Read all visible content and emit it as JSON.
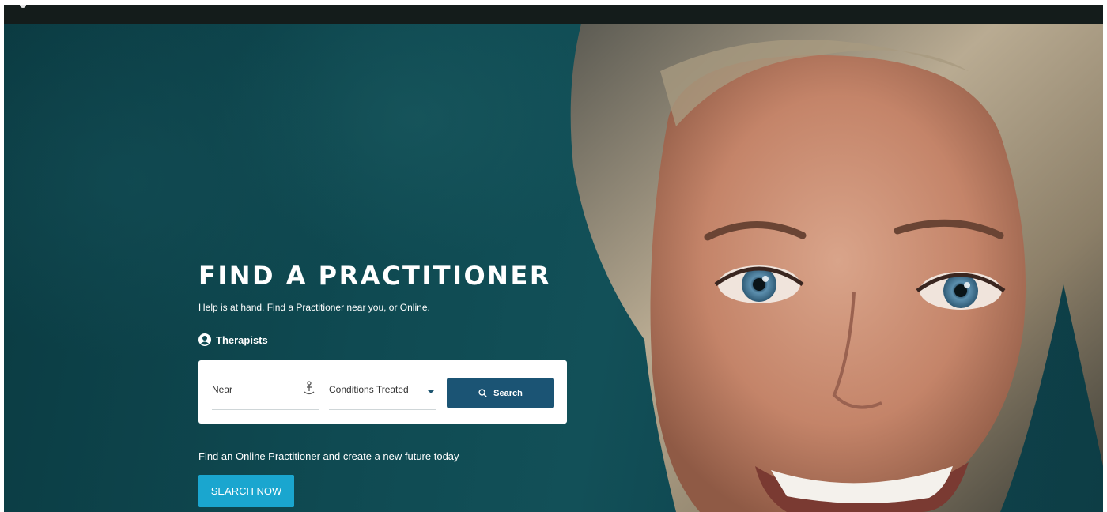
{
  "hero": {
    "title": "FIND A PRACTITIONER",
    "subtitle": "Help is at hand. Find a Practitioner near you, or Online.",
    "tab_label": "Therapists"
  },
  "search": {
    "near_placeholder": "Near",
    "conditions_label": "Conditions Treated",
    "button_label": "Search"
  },
  "online": {
    "text": "Find an Online Practitioner and create a new future today",
    "button_label": "SEARCH NOW"
  },
  "colors": {
    "hero_background": "#0f4a52",
    "search_button": "#1b5474",
    "search_now_button": "#1aa6cf",
    "topbar": "#141c1b"
  },
  "icons": {
    "tab": "user-circle-icon",
    "near": "location-pin-icon",
    "dropdown": "caret-down-icon",
    "search": "search-icon"
  }
}
